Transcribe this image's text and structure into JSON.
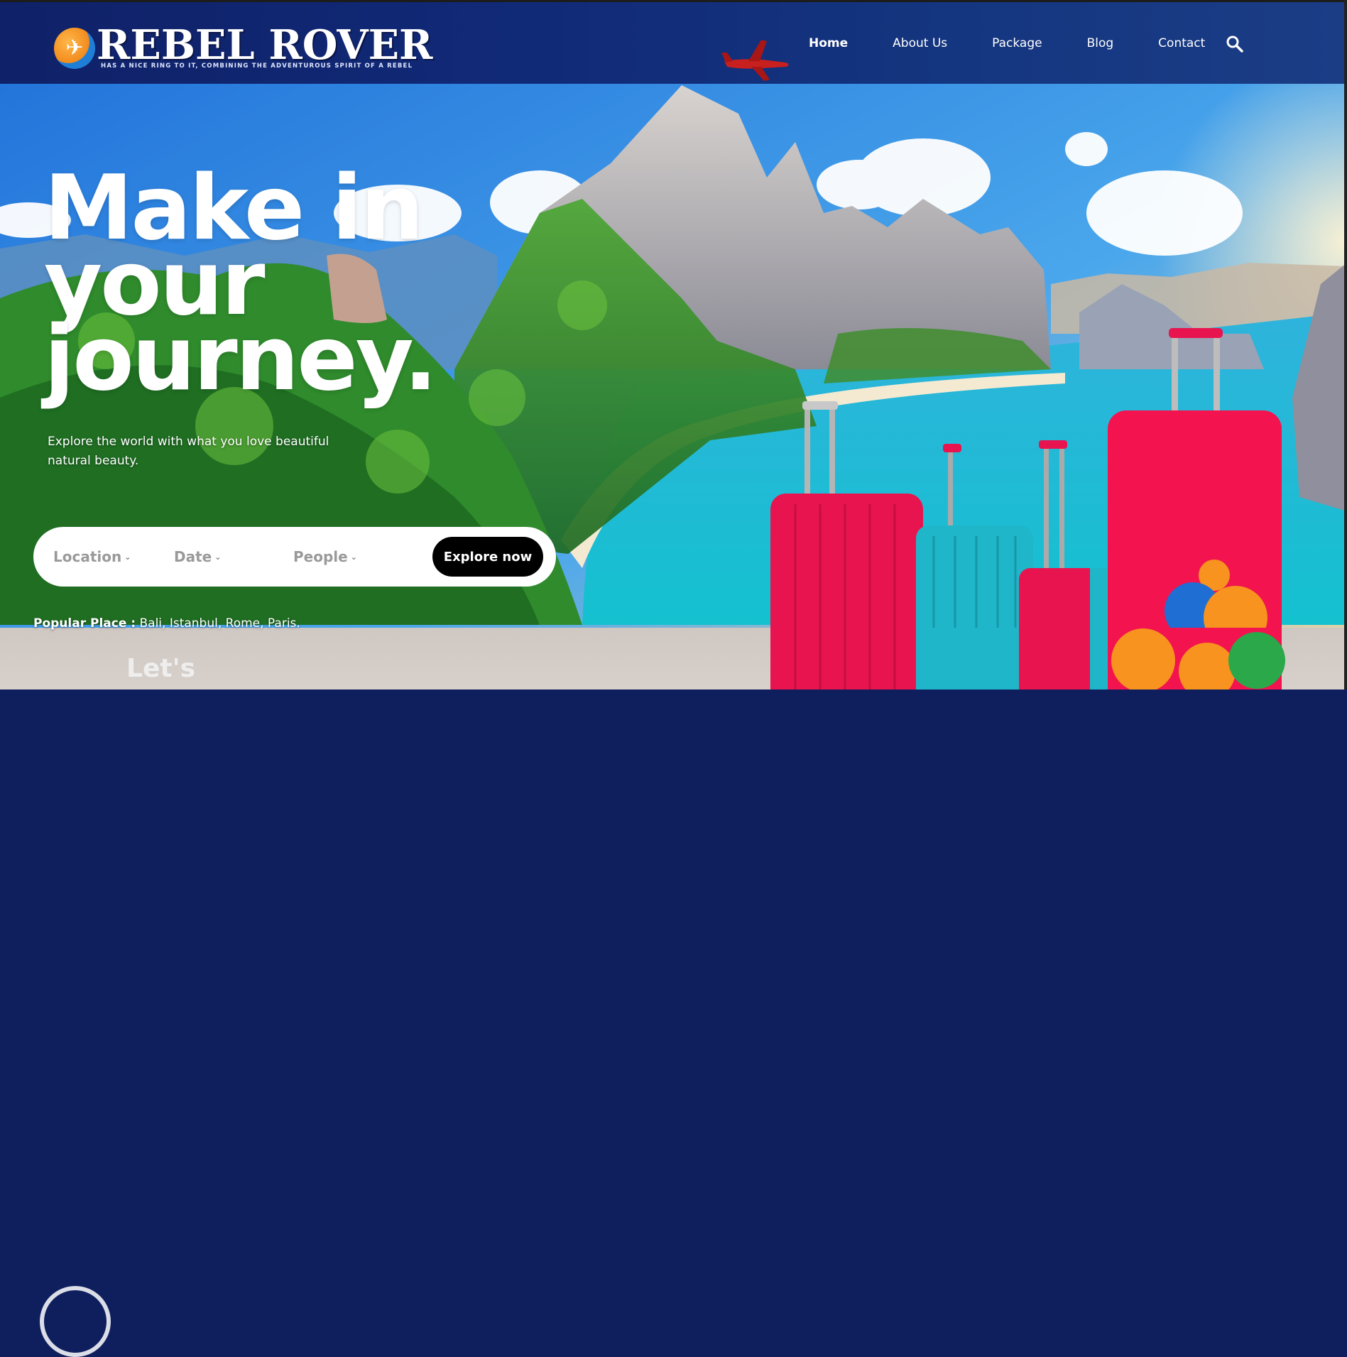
{
  "brand": {
    "title": "REBEL ROVER",
    "tagline": "HAS A NICE RING TO IT, COMBINING THE ADVENTUROUS SPIRIT OF A REBEL",
    "logo_icon": "airplane-globe-icon"
  },
  "nav": {
    "items": [
      {
        "label": "Home",
        "active": true
      },
      {
        "label": "About Us",
        "active": false
      },
      {
        "label": "Package",
        "active": false
      },
      {
        "label": "Blog",
        "active": false
      },
      {
        "label": "Contact",
        "active": false
      }
    ],
    "search_icon": "search-icon"
  },
  "hero": {
    "title_line1": "Make in",
    "title_line2": "your",
    "title_line3": "journey.",
    "subtitle": "Explore the world with what you love beautiful natural beauty."
  },
  "search": {
    "location": "Location",
    "date": "Date",
    "people": "People",
    "button": "Explore now"
  },
  "popular": {
    "label": "Popular Place :",
    "places": "Bali, Istanbul, Rome, Paris."
  },
  "next_section": {
    "heading_partial": "Let's"
  },
  "colors": {
    "header_bg": "#0f2168",
    "button_bg": "#000000",
    "suitcase_pink": "#e8144f",
    "suitcase_teal": "#1fb6c9"
  }
}
